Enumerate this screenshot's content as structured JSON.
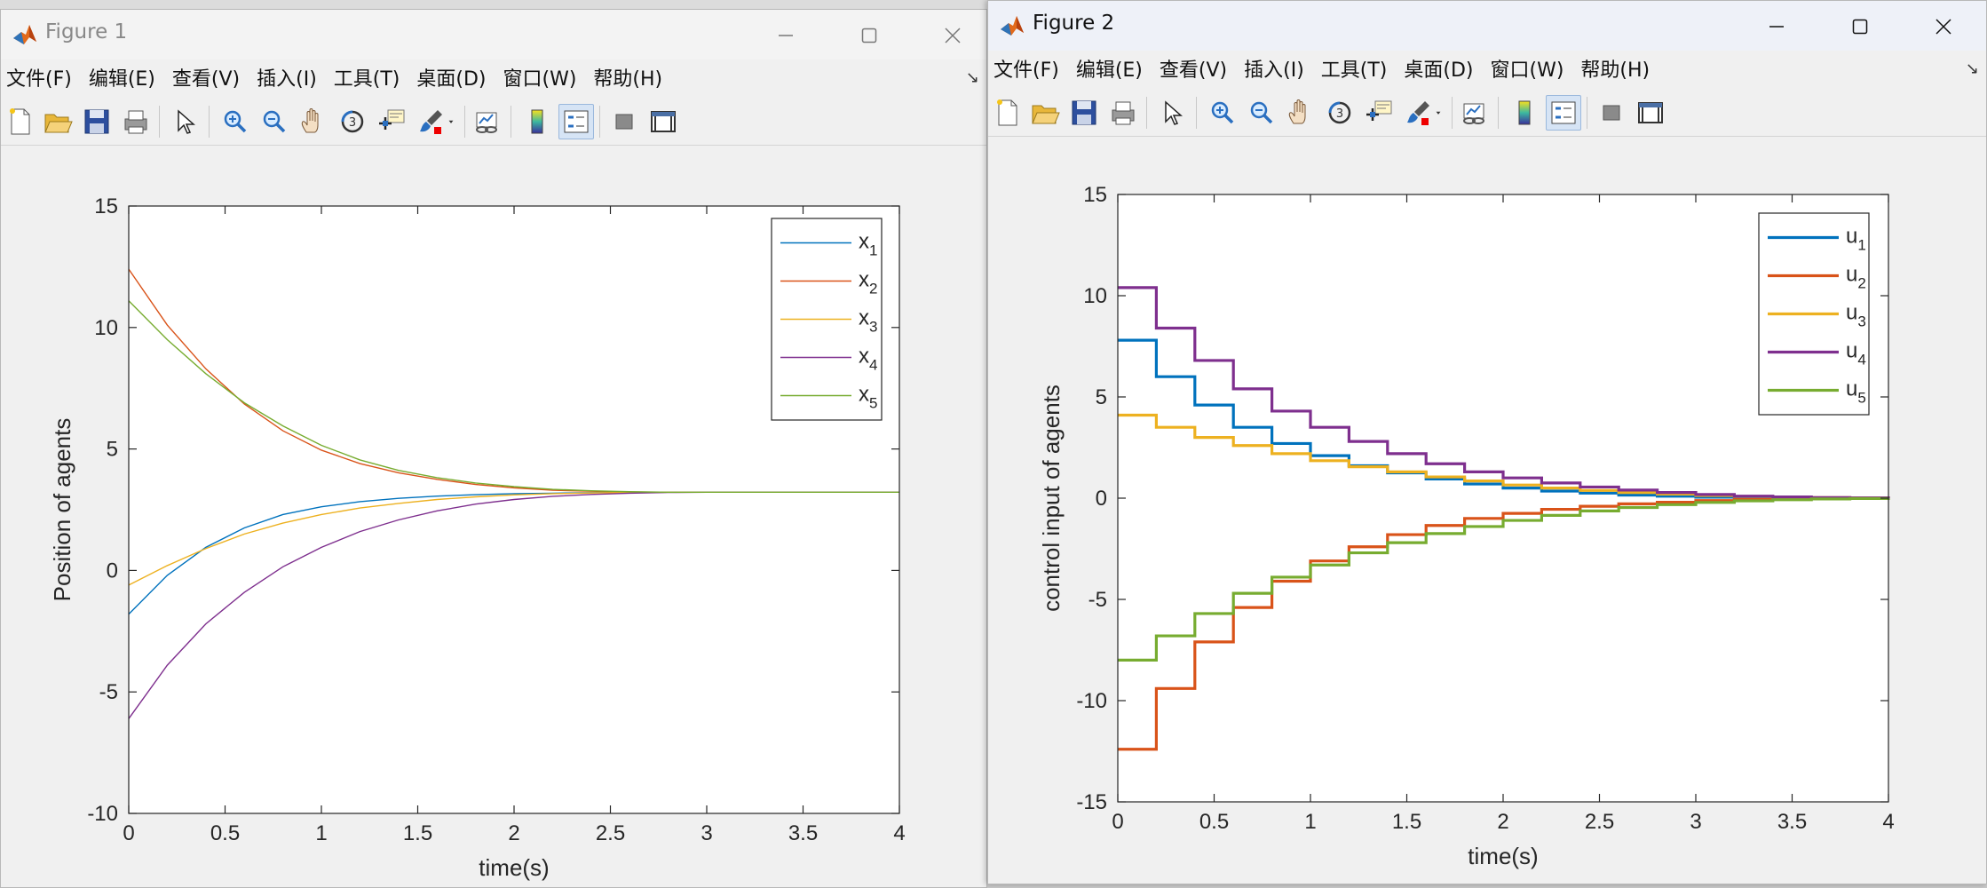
{
  "figure1": {
    "title": "Figure 1",
    "menu": [
      "文件(F)",
      "编辑(E)",
      "查看(V)",
      "插入(I)",
      "工具(T)",
      "桌面(D)",
      "窗口(W)",
      "帮助(H)"
    ],
    "toolbar_icons": [
      "new-file-icon",
      "open-folder-icon",
      "save-icon",
      "print-icon",
      "pointer-icon",
      "zoom-in-icon",
      "zoom-out-icon",
      "pan-icon",
      "rotate-3d-icon",
      "data-cursor-icon",
      "brush-icon",
      "brush-dropdown-icon",
      "link-plot-icon",
      "colorbar-icon",
      "legend-icon",
      "hide-plot-tools-icon",
      "show-plot-tools-icon"
    ],
    "chart_data": {
      "type": "line",
      "title": "",
      "xlabel": "time(s)",
      "ylabel": "Position of agents",
      "xlim": [
        0,
        4
      ],
      "ylim": [
        -10,
        15
      ],
      "xticks": [
        "0",
        "0.5",
        "1",
        "1.5",
        "2",
        "2.5",
        "3",
        "3.5",
        "4"
      ],
      "yticks": [
        "-10",
        "-5",
        "0",
        "5",
        "10",
        "15"
      ],
      "x": [
        0,
        0.2,
        0.4,
        0.6,
        0.8,
        1.0,
        1.2,
        1.4,
        1.6,
        1.8,
        2.0,
        2.2,
        2.4,
        2.6,
        2.8,
        3.0,
        3.5,
        4.0
      ],
      "series": [
        {
          "name": "x1",
          "legend_main": "x",
          "legend_sub": "1",
          "color": "#0072BD",
          "values": [
            -1.8,
            -0.2,
            0.95,
            1.75,
            2.3,
            2.62,
            2.83,
            2.97,
            3.06,
            3.12,
            3.16,
            3.18,
            3.2,
            3.21,
            3.22,
            3.22,
            3.22,
            3.22
          ]
        },
        {
          "name": "x2",
          "legend_main": "x",
          "legend_sub": "2",
          "color": "#D95319",
          "values": [
            12.4,
            10.1,
            8.3,
            6.85,
            5.75,
            4.95,
            4.4,
            4.02,
            3.75,
            3.54,
            3.4,
            3.3,
            3.26,
            3.23,
            3.22,
            3.22,
            3.22,
            3.22
          ]
        },
        {
          "name": "x3",
          "legend_main": "x",
          "legend_sub": "3",
          "color": "#EDB120",
          "values": [
            -0.6,
            0.2,
            0.9,
            1.5,
            1.95,
            2.3,
            2.57,
            2.76,
            2.92,
            3.03,
            3.11,
            3.16,
            3.19,
            3.21,
            3.22,
            3.22,
            3.22,
            3.22
          ]
        },
        {
          "name": "x4",
          "legend_main": "x",
          "legend_sub": "4",
          "color": "#7E2F8E",
          "values": [
            -6.1,
            -3.9,
            -2.2,
            -0.9,
            0.15,
            0.95,
            1.6,
            2.08,
            2.45,
            2.73,
            2.92,
            3.05,
            3.13,
            3.18,
            3.21,
            3.22,
            3.22,
            3.22
          ]
        },
        {
          "name": "x5",
          "legend_main": "x",
          "legend_sub": "5",
          "color": "#77AC30",
          "values": [
            11.1,
            9.5,
            8.1,
            6.9,
            5.95,
            5.15,
            4.55,
            4.12,
            3.82,
            3.6,
            3.45,
            3.34,
            3.28,
            3.24,
            3.22,
            3.22,
            3.22,
            3.22
          ]
        }
      ],
      "legend_position": "top-right",
      "grid": false
    }
  },
  "figure2": {
    "title": "Figure 2",
    "menu": [
      "文件(F)",
      "编辑(E)",
      "查看(V)",
      "插入(I)",
      "工具(T)",
      "桌面(D)",
      "窗口(W)",
      "帮助(H)"
    ],
    "toolbar_icons": [
      "new-file-icon",
      "open-folder-icon",
      "save-icon",
      "print-icon",
      "pointer-icon",
      "zoom-in-icon",
      "zoom-out-icon",
      "pan-icon",
      "rotate-3d-icon",
      "data-cursor-icon",
      "brush-icon",
      "brush-dropdown-icon",
      "link-plot-icon",
      "colorbar-icon",
      "legend-icon",
      "hide-plot-tools-icon",
      "show-plot-tools-icon"
    ],
    "chart_data": {
      "type": "line",
      "step": true,
      "title": "",
      "xlabel": "time(s)",
      "ylabel": "control input of agents",
      "xlim": [
        0,
        4
      ],
      "ylim": [
        -15,
        15
      ],
      "xticks": [
        "0",
        "0.5",
        "1",
        "1.5",
        "2",
        "2.5",
        "3",
        "3.5",
        "4"
      ],
      "yticks": [
        "-15",
        "-10",
        "-5",
        "0",
        "5",
        "10",
        "15"
      ],
      "x": [
        0,
        0.2,
        0.4,
        0.6,
        0.8,
        1.0,
        1.2,
        1.4,
        1.6,
        1.8,
        2.0,
        2.2,
        2.4,
        2.6,
        2.8,
        3.0,
        3.2,
        3.4,
        3.6,
        3.8,
        4.0
      ],
      "series": [
        {
          "name": "u1",
          "legend_main": "u",
          "legend_sub": "1",
          "color": "#0072BD",
          "values": [
            7.8,
            6.0,
            4.6,
            3.5,
            2.7,
            2.1,
            1.6,
            1.25,
            0.95,
            0.7,
            0.5,
            0.35,
            0.25,
            0.15,
            0.1,
            0.05,
            0.03,
            0.02,
            0.01,
            0,
            0
          ]
        },
        {
          "name": "u2",
          "legend_main": "u",
          "legend_sub": "2",
          "color": "#D95319",
          "values": [
            -12.4,
            -9.4,
            -7.1,
            -5.4,
            -4.1,
            -3.1,
            -2.4,
            -1.8,
            -1.35,
            -1.0,
            -0.75,
            -0.55,
            -0.4,
            -0.28,
            -0.2,
            -0.12,
            -0.07,
            -0.04,
            -0.02,
            0,
            0
          ]
        },
        {
          "name": "u3",
          "legend_main": "u",
          "legend_sub": "3",
          "color": "#EDB120",
          "values": [
            4.1,
            3.5,
            3.0,
            2.6,
            2.2,
            1.85,
            1.55,
            1.3,
            1.05,
            0.85,
            0.65,
            0.5,
            0.38,
            0.28,
            0.2,
            0.13,
            0.08,
            0.05,
            0.03,
            0.01,
            0
          ]
        },
        {
          "name": "u4",
          "legend_main": "u",
          "legend_sub": "4",
          "color": "#7E2F8E",
          "values": [
            10.4,
            8.4,
            6.8,
            5.4,
            4.3,
            3.5,
            2.8,
            2.2,
            1.7,
            1.3,
            1.0,
            0.75,
            0.55,
            0.4,
            0.28,
            0.18,
            0.1,
            0.06,
            0.03,
            0.01,
            0
          ]
        },
        {
          "name": "u5",
          "legend_main": "u",
          "legend_sub": "5",
          "color": "#77AC30",
          "values": [
            -8.0,
            -6.8,
            -5.7,
            -4.7,
            -3.9,
            -3.3,
            -2.7,
            -2.2,
            -1.75,
            -1.4,
            -1.1,
            -0.85,
            -0.63,
            -0.46,
            -0.32,
            -0.21,
            -0.13,
            -0.08,
            -0.04,
            -0.02,
            0
          ]
        }
      ],
      "legend_position": "top-right",
      "grid": false
    }
  }
}
